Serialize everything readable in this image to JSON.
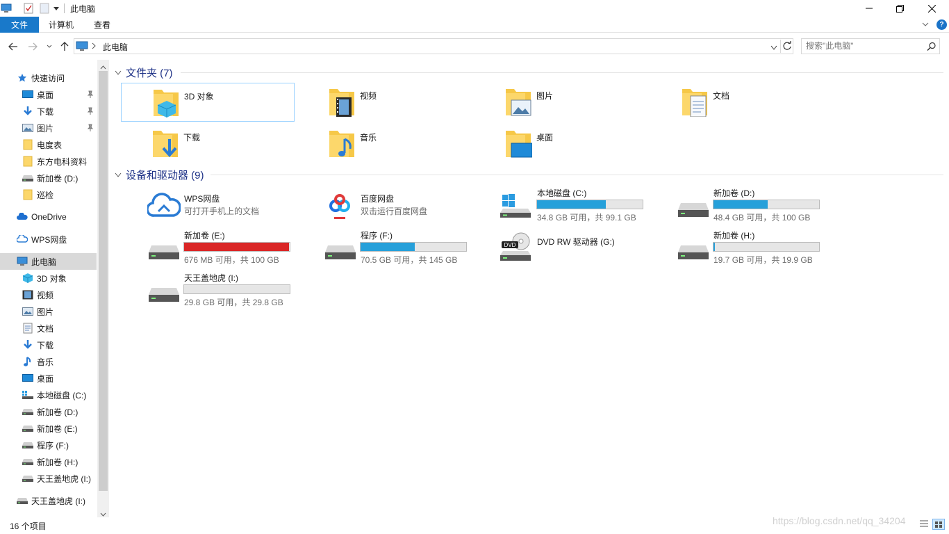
{
  "window": {
    "title": "此电脑"
  },
  "ribbon": {
    "tabs": [
      "文件",
      "计算机",
      "查看"
    ],
    "help": "?"
  },
  "navigation": {
    "address_location": "此电脑",
    "search_placeholder": "搜索\"此电脑\""
  },
  "navpane": {
    "quick_access": "快速访问",
    "quick_items": [
      {
        "label": "桌面",
        "pinned": true
      },
      {
        "label": "下载",
        "pinned": true
      },
      {
        "label": "图片",
        "pinned": true
      },
      {
        "label": "电度表",
        "pinned": false
      },
      {
        "label": "东方电科资料",
        "pinned": false
      },
      {
        "label": "新加卷 (D:)",
        "pinned": false
      },
      {
        "label": "巡检",
        "pinned": false
      }
    ],
    "onedrive": "OneDrive",
    "wps": "WPS网盘",
    "this_pc": "此电脑",
    "pc_items": [
      "3D 对象",
      "视频",
      "图片",
      "文档",
      "下载",
      "音乐",
      "桌面",
      "本地磁盘 (C:)",
      "新加卷 (D:)",
      "新加卷 (E:)",
      "程序 (F:)",
      "新加卷 (H:)",
      "天王盖地虎 (I:)"
    ],
    "removable": "天王盖地虎 (I:)"
  },
  "content": {
    "folders_header": "文件夹 (7)",
    "folders": [
      "3D 对象",
      "视频",
      "图片",
      "文档",
      "下载",
      "音乐",
      "桌面"
    ],
    "devices_header": "设备和驱动器 (9)",
    "cloud": [
      {
        "name": "WPS网盘",
        "desc": "可打开手机上的文档"
      },
      {
        "name": "百度网盘",
        "desc": "双击运行百度网盘"
      }
    ],
    "drives": [
      {
        "name": "本地磁盘 (C:)",
        "info": "34.8 GB 可用，共 99.1 GB",
        "used_fraction": 0.649,
        "color": "#26a0da"
      },
      {
        "name": "新加卷 (D:)",
        "info": "48.4 GB 可用，共 100 GB",
        "used_fraction": 0.516,
        "color": "#26a0da"
      },
      {
        "name": "新加卷 (E:)",
        "info": "676 MB 可用，共 100 GB",
        "used_fraction": 0.993,
        "color": "#da2626"
      },
      {
        "name": "程序 (F:)",
        "info": "70.5 GB 可用，共 145 GB",
        "used_fraction": 0.514,
        "color": "#26a0da"
      },
      {
        "name": "新加卷 (H:)",
        "info": "19.7 GB 可用，共 19.9 GB",
        "used_fraction": 0.01,
        "color": "#26a0da"
      },
      {
        "name": "天王盖地虎 (I:)",
        "info": "29.8 GB 可用，共 29.8 GB",
        "used_fraction": 0.0,
        "color": "#26a0da"
      }
    ],
    "dvd": {
      "name": "DVD RW 驱动器 (G:)",
      "badge": "DVD"
    }
  },
  "statusbar": {
    "count": "16 个项目",
    "watermark": "https://blog.csdn.net/qq_34204"
  }
}
